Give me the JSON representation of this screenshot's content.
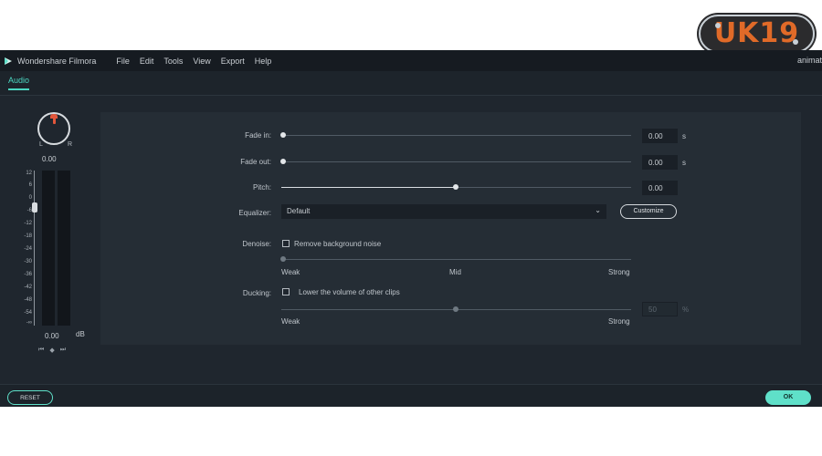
{
  "logo": {
    "text": "UK19",
    "accent": "#e06a28"
  },
  "menubar": {
    "app_name": "Wondershare Filmora",
    "items": [
      "File",
      "Edit",
      "Tools",
      "View",
      "Export",
      "Help"
    ],
    "right_text": "animat"
  },
  "tabs": {
    "active": "Audio"
  },
  "meter": {
    "pan_left": "L",
    "pan_right": "R",
    "pan_value": "0.00",
    "scale_ticks": [
      "12",
      "6",
      "0",
      "-6",
      "-12",
      "-18",
      "-24",
      "-30",
      "-36",
      "-42",
      "-48",
      "-54",
      "-∞"
    ],
    "volume_value": "0.00",
    "unit": "dB"
  },
  "settings": {
    "fade_in": {
      "label": "Fade in:",
      "value": "0.00",
      "unit": "s",
      "level": 0
    },
    "fade_out": {
      "label": "Fade out:",
      "value": "0.00",
      "unit": "s",
      "level": 0
    },
    "pitch": {
      "label": "Pitch:",
      "value": "0.00",
      "level": 0.5
    },
    "equalizer": {
      "label": "Equalizer:",
      "selected": "Default",
      "customize_label": "Customize"
    },
    "denoise": {
      "label": "Denoise:",
      "checkbox_label": "Remove background noise",
      "checked": false,
      "weak": "Weak",
      "mid": "Mid",
      "strong": "Strong",
      "level": 0
    },
    "ducking": {
      "label": "Ducking:",
      "checkbox_label": "Lower the volume of other clips",
      "checked": false,
      "weak": "Weak",
      "strong": "Strong",
      "value": "50",
      "unit": "%",
      "level": 0.5
    }
  },
  "footer": {
    "reset_label": "RESET",
    "ok_label": "OK"
  },
  "colors": {
    "accent": "#5fe0c9",
    "background": "#1f262e",
    "panel": "#252d35"
  }
}
